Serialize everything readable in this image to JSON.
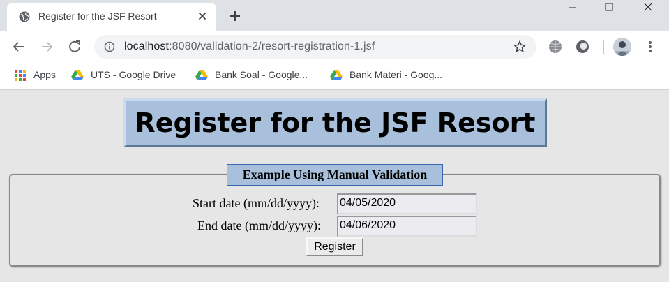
{
  "browser": {
    "tab": {
      "title": "Register for the JSF Resort"
    },
    "url": {
      "host": "localhost",
      "rest": ":8080/validation-2/resort-registration-1.jsf"
    },
    "bookmarks": [
      {
        "label": "Apps",
        "icon": "apps-grid-icon"
      },
      {
        "label": "UTS - Google Drive",
        "icon": "google-drive-icon"
      },
      {
        "label": "Bank Soal - Google...",
        "icon": "google-drive-icon"
      },
      {
        "label": "Bank Materi - Goog...",
        "icon": "google-drive-icon"
      }
    ]
  },
  "page": {
    "title": "Register for the JSF Resort",
    "legend": "Example Using Manual Validation",
    "start_label": "Start date (mm/dd/yyyy):",
    "start_value": "04/05/2020",
    "end_label": "End date (mm/dd/yyyy):",
    "end_value": "04/06/2020",
    "submit_label": "Register"
  },
  "colors": {
    "header_bg": "#a8c0db",
    "page_bg": "#e6e6e6",
    "tabstrip_bg": "#dee1e6"
  }
}
